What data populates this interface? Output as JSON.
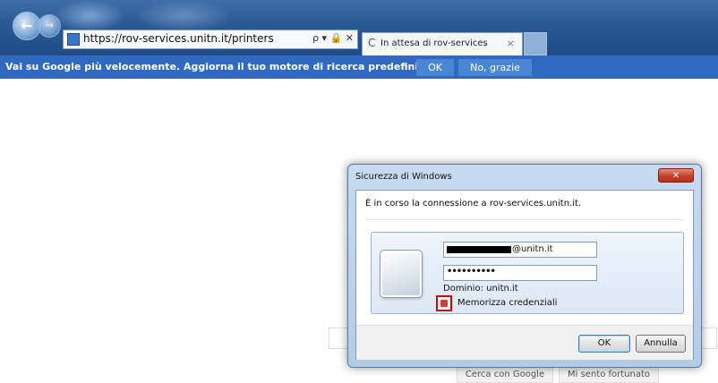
{
  "browser": {
    "back_glyph": "←",
    "forward_glyph": "→",
    "address": {
      "url": "https://rov-services.unitn.it/printers",
      "icons": "ρ ▾ 🔒 ✕"
    },
    "tab": {
      "spinner": "C",
      "title": "In attesa di rov-services",
      "close": "×"
    }
  },
  "notification_bar": {
    "message": "Vai su Google più velocemente. Aggiorna il tuo motore di ricerca predefinito.",
    "ok_label": "OK",
    "no_label": "No, grazie"
  },
  "page": {
    "search_button": "Cerca con Google",
    "lucky_button": "Mi sento fortunato"
  },
  "dialog": {
    "title": "Sicurezza di Windows",
    "close_glyph": "✕",
    "message": "È in corso la connessione a rov-services.unitn.it.",
    "username_suffix": "@unitn.it",
    "password_mask": "••••••••••",
    "domain_label": "Dominio: unitn.it",
    "remember_label": "Memorizza credenziali",
    "remember_checked": true,
    "ok_label": "OK",
    "cancel_label": "Annulla"
  }
}
